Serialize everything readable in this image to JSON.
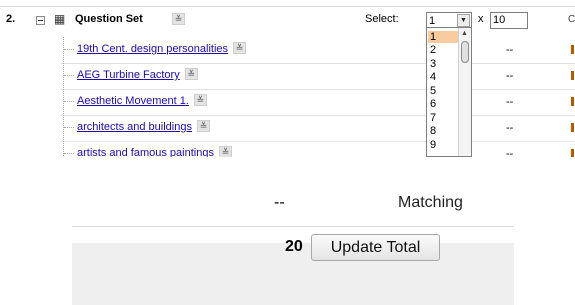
{
  "question_set": {
    "number": "2.",
    "title": "Question Set",
    "menu_icon_glyph": "≚",
    "select_label": "Select:",
    "select_value": "1",
    "select_arrow": "▼",
    "times": "x",
    "quantity": "10",
    "edge_char": "C"
  },
  "items": [
    {
      "title": "19th Cent. design personalities",
      "value": "--"
    },
    {
      "title": "AEG Turbine Factory",
      "value": "--"
    },
    {
      "title": "Aesthetic Movement 1.",
      "value": "--"
    },
    {
      "title": "architects and buildings",
      "value": "--"
    },
    {
      "title": "artists and famous paintings",
      "value": "--"
    }
  ],
  "dropdown": {
    "options": [
      "1",
      "2",
      "3",
      "4",
      "5",
      "6",
      "7",
      "8",
      "9"
    ],
    "selected": "1",
    "scroll_up": "▲"
  },
  "summary": {
    "points": "--",
    "type": "Matching",
    "total": "20",
    "update_button": "Update Total"
  }
}
